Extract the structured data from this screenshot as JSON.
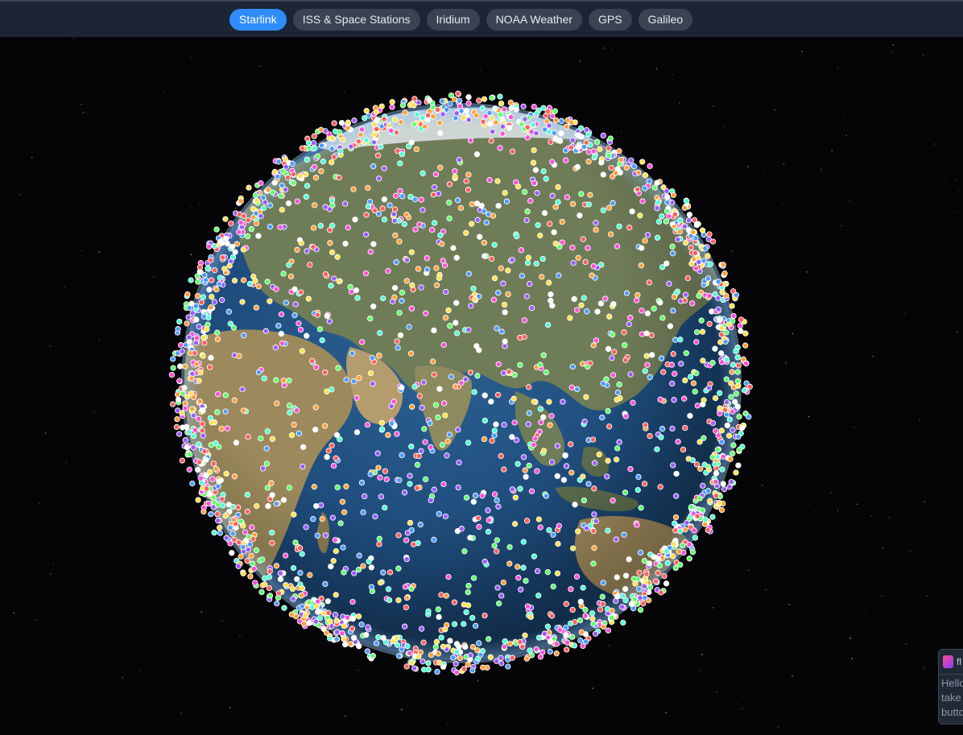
{
  "nav": {
    "tabs": [
      {
        "label": "Starlink",
        "active": true
      },
      {
        "label": "ISS & Space Stations",
        "active": false
      },
      {
        "label": "Iridium",
        "active": false
      },
      {
        "label": "NOAA Weather",
        "active": false
      },
      {
        "label": "GPS",
        "active": false
      },
      {
        "label": "Galileo",
        "active": false
      }
    ]
  },
  "globe": {
    "ocean_color": "#1f4a78",
    "land_color": "#6d7a56",
    "desert_color": "#b49a6a",
    "ice_color": "#dfe6ea",
    "satellite_colors": [
      "#ff4fd8",
      "#ffe14f",
      "#4fffd2",
      "#4f9bff",
      "#ff5e5e",
      "#9b5bff",
      "#5eff6b",
      "#ff9f3a",
      "#ffffff"
    ]
  },
  "chat_widget": {
    "title": "fl",
    "lines": [
      "Hello",
      "take",
      "butto"
    ]
  }
}
